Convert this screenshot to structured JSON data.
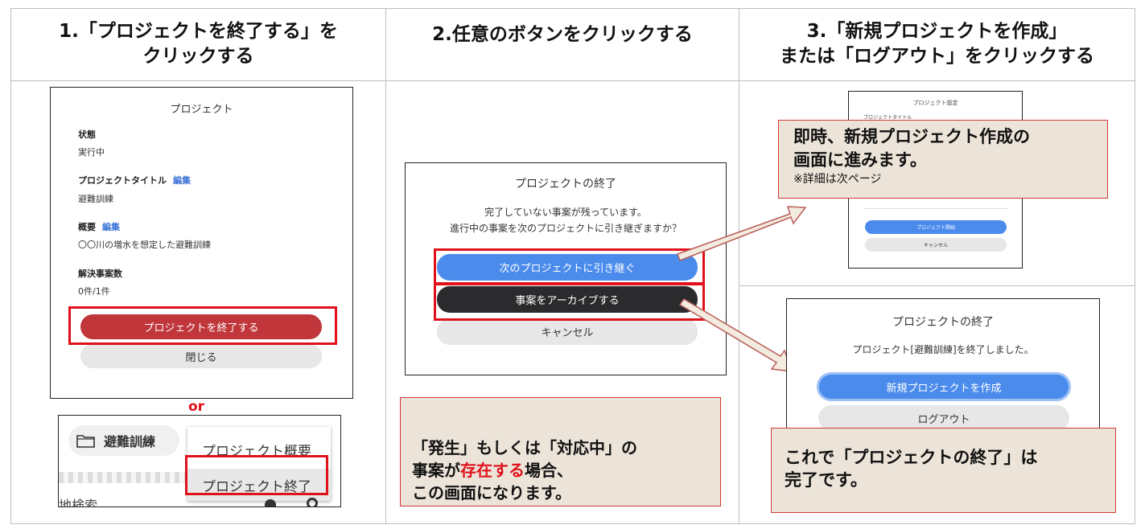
{
  "headers": {
    "col1": "1.「プロジェクトを終了する」を\nクリックする",
    "col2": "2.任意のボタンをクリックする",
    "col3": "3.「新規プロジェクトを作成」\nまたは「ログアウト」をクリックする"
  },
  "panel1": {
    "title": "プロジェクト",
    "status_label": "状態",
    "status_value": "実行中",
    "project_title_label": "プロジェクトタイトル",
    "edit_label": "編集",
    "project_title_value": "避難訓練",
    "summary_label": "概要",
    "summary_value": "〇〇川の増水を想定した避難訓練",
    "resolved_label": "解決事案数",
    "resolved_value": "0件/1件",
    "end_button": "プロジェクトを終了する",
    "close_button": "閉じる",
    "or_text": "or",
    "menu_project_name": "避難訓練",
    "menu_item_overview": "プロジェクト概要",
    "menu_item_end": "プロジェクト終了",
    "cut_text": "地検索"
  },
  "panel2": {
    "dialog_title": "プロジェクトの終了",
    "message_line1": "完了していない事案が残っています。",
    "message_line2": "進行中の事案を次のプロジェクトに引き継ぎますか？",
    "carry_button": "次のプロジェクトに引き継ぐ",
    "archive_button": "事案をアーカイブする",
    "cancel_button": "キャンセル",
    "note_pre": "「発生」もしくは「対応中」の\n事案が",
    "note_highlight": "存在する",
    "note_post": "場合、\nこの画面になります。"
  },
  "panel3": {
    "settings_title": "プロジェクト設定",
    "settings_field_label": "プロジェクトタイトル",
    "start_button": "プロジェクト開始",
    "settings_cancel": "キャンセル",
    "note1_main": "即時、新規プロジェクト作成の\n画面に進みます。",
    "note1_sub": "※詳細は次ページ",
    "dialog_title": "プロジェクトの終了",
    "dialog_message": "プロジェクト[避難訓練]を終了しました。",
    "create_button": "新規プロジェクトを作成",
    "logout_button": "ログアウト",
    "note2": "これで「プロジェクトの終了」は\n完了です。"
  },
  "colors": {
    "red_highlight": "#e0111b",
    "note_bg": "#ece4d9",
    "end_button": "#c0363a",
    "blue_button": "#4b8bec",
    "dark_button": "#2b2b2e"
  }
}
